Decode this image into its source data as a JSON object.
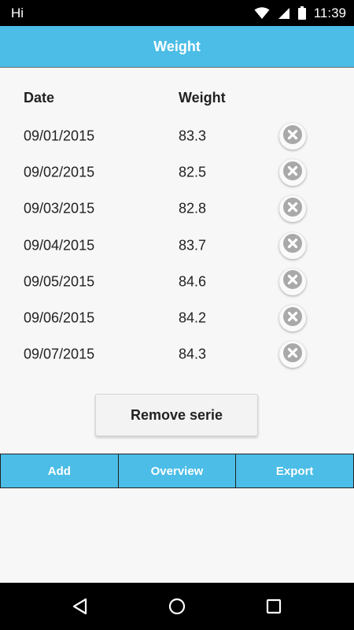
{
  "status_bar": {
    "carrier": "Hi",
    "time": "11:39",
    "icons": [
      "wifi-icon",
      "signal-icon",
      "battery-icon"
    ]
  },
  "app_bar": {
    "title": "Weight"
  },
  "table": {
    "headers": {
      "date": "Date",
      "weight": "Weight"
    },
    "rows": [
      {
        "date": "09/01/2015",
        "weight": "83.3"
      },
      {
        "date": "09/02/2015",
        "weight": "82.5"
      },
      {
        "date": "09/03/2015",
        "weight": "82.8"
      },
      {
        "date": "09/04/2015",
        "weight": "83.7"
      },
      {
        "date": "09/05/2015",
        "weight": "84.6"
      },
      {
        "date": "09/06/2015",
        "weight": "84.2"
      },
      {
        "date": "09/07/2015",
        "weight": "84.3"
      }
    ],
    "row_action_icon": "remove-circle-icon"
  },
  "remove_serie_label": "Remove serie",
  "bottom_tabs": [
    "Add",
    "Overview",
    "Export"
  ],
  "nav_bar": {
    "icons": [
      "back-icon",
      "home-icon",
      "recents-icon"
    ]
  },
  "colors": {
    "accent": "#4bbde6",
    "background": "#f7f7f7",
    "system_bar": "#000000"
  }
}
